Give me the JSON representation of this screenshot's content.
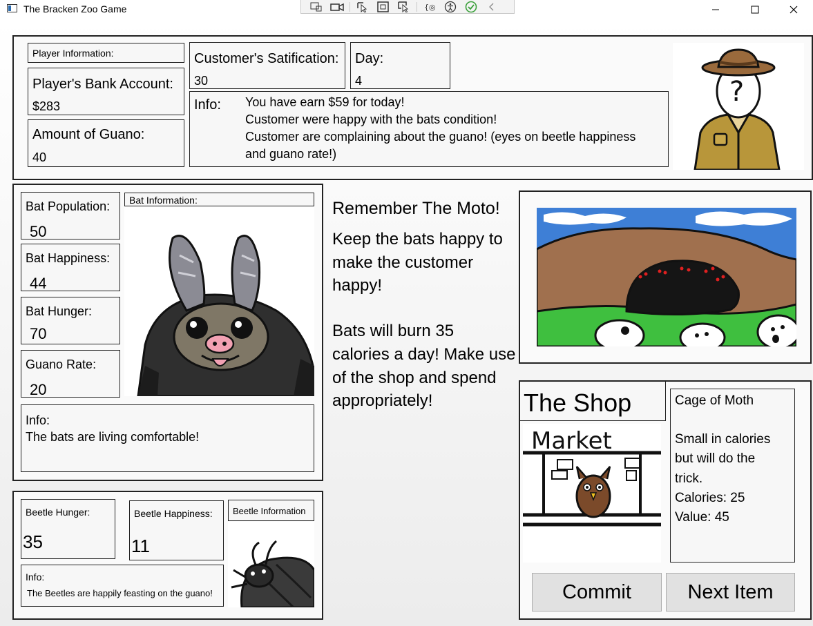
{
  "window": {
    "title": "The Bracken Zoo Game",
    "debug_tools": [
      "select-element-icon",
      "record-icon",
      "pointer-icon",
      "frame-icon",
      "hover-icon",
      "bindings-icon",
      "accessibility-icon",
      "check-icon",
      "collapse-icon"
    ]
  },
  "player": {
    "header": "Player Information:",
    "bank_label": "Player's Bank Account:",
    "bank_value": "$283",
    "guano_label": "Amount of Guano:",
    "guano_value": "40",
    "satisfaction_label": "Customer's Satification:",
    "satisfaction_value": "30",
    "day_label": "Day:",
    "day_value": "4",
    "info_label": "Info:",
    "info_lines": [
      "You have earn $59 for today!",
      "Customer were happy with the bats condition!",
      "Customer are complaining about the guano! (eyes on beetle happiness",
      "and guano rate!)"
    ]
  },
  "bats": {
    "header": "Bat Information:",
    "population_label": "Bat Population:",
    "population_value": "50",
    "happiness_label": "Bat Happiness:",
    "happiness_value": "44",
    "hunger_label": "Bat Hunger:",
    "hunger_value": "70",
    "guano_rate_label": "Guano Rate:",
    "guano_rate_value": "20",
    "info_label": "Info:",
    "info_text": "The bats are living comfortable!"
  },
  "beetles": {
    "header": "Beetle Information",
    "hunger_label": "Beetle Hunger:",
    "hunger_value": "35",
    "happiness_label": "Beetle Happiness:",
    "happiness_value": "11",
    "info_label": "Info:",
    "info_text": "The Beetles are happily feasting on the guano!"
  },
  "motto": {
    "title": "Remember The Moto!",
    "lines_1": [
      "Keep the bats happy to",
      "make the customer",
      "happy!"
    ],
    "lines_2": [
      "Bats will burn 35",
      "calories a day! Make use",
      "of the shop and spend",
      "appropriately!"
    ]
  },
  "shop": {
    "title": "The Shop",
    "market_sign": "Market",
    "item_name": "Cage of Moth",
    "item_desc": [
      "Small in calories",
      "but will do the",
      "trick."
    ],
    "calories": "Calories: 25",
    "value": "Value: 45",
    "commit_label": "Commit",
    "next_label": "Next Item"
  },
  "colors": {
    "accent_check": "#3aa03a",
    "ranger_uniform": "#b8963a",
    "hat": "#9a6a3c",
    "bat_body": "#2f2f2f",
    "bat_face": "#7f7766",
    "sky": "#3e7fd6",
    "grass": "#3fbf3f",
    "dirt": "#a0704e",
    "owl": "#7b4a2a"
  }
}
